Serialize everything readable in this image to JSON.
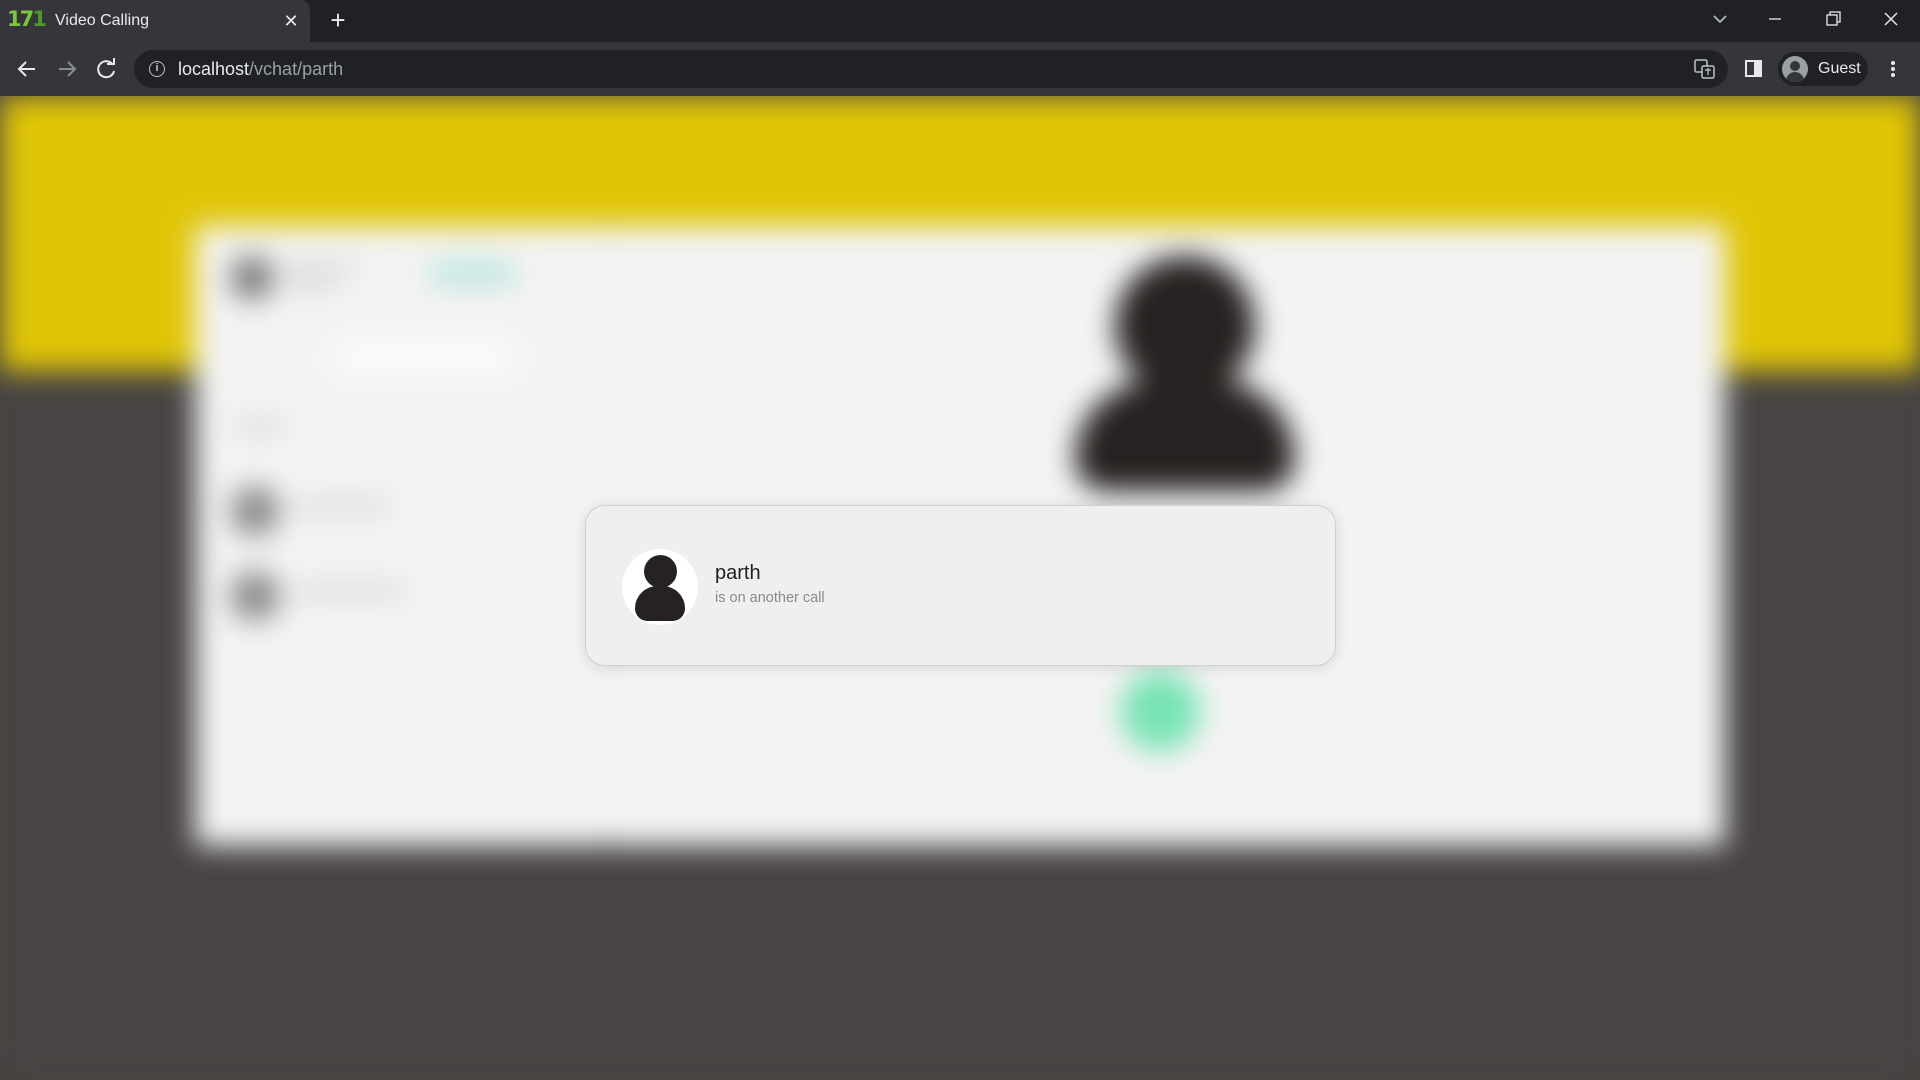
{
  "browser": {
    "tab": {
      "favicon_text": "17",
      "favicon_text_b": "1",
      "title": "Video Calling",
      "close_glyph": "✕"
    },
    "new_tab_glyph": "+",
    "omnibox": {
      "host": "localhost",
      "path": "/vchat/parth"
    },
    "profile": {
      "label": "Guest"
    }
  },
  "call_modal": {
    "name": "parth",
    "status": "is on another call"
  },
  "colors": {
    "accent_yellow": "#e0c506",
    "backdrop_dark": "#474443",
    "call_green": "#78e4b6",
    "favicon_green": "#7cc63e"
  }
}
